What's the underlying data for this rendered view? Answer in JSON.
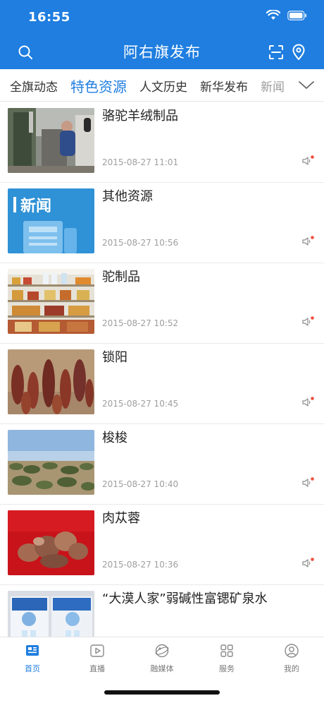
{
  "status": {
    "time": "16:55"
  },
  "header": {
    "title": "阿右旗发布"
  },
  "tabs": {
    "items": [
      {
        "label": "全旗动态"
      },
      {
        "label": "特色资源"
      },
      {
        "label": "人文历史"
      },
      {
        "label": "新华发布"
      },
      {
        "label": "新闻"
      }
    ],
    "active_index": 1
  },
  "articles": [
    {
      "title": "骆驼羊绒制品",
      "date": "2015-08-27 11:01",
      "thumb": "weaving-workshop"
    },
    {
      "title": "其他资源",
      "date": "2015-08-27 10:56",
      "thumb": "news-placeholder",
      "thumb_text": "新闻"
    },
    {
      "title": "驼制品",
      "date": "2015-08-27 10:52",
      "thumb": "product-shelf"
    },
    {
      "title": "锁阳",
      "date": "2015-08-27 10:45",
      "thumb": "cynomorium-plants"
    },
    {
      "title": "梭梭",
      "date": "2015-08-27 10:40",
      "thumb": "desert-shrubland"
    },
    {
      "title": "肉苁蓉",
      "date": "2015-08-27 10:36",
      "thumb": "cistanche-roots"
    },
    {
      "title": "“大漠人家”弱碱性富锶矿泉水",
      "date": "",
      "thumb": "water-boxes"
    }
  ],
  "tabbar": {
    "items": [
      {
        "label": "首页",
        "icon": "home-news-icon"
      },
      {
        "label": "直播",
        "icon": "play-icon"
      },
      {
        "label": "融媒体",
        "icon": "globe-icon"
      },
      {
        "label": "服务",
        "icon": "grid-icon"
      },
      {
        "label": "我的",
        "icon": "user-icon"
      }
    ],
    "active_index": 0
  },
  "colors": {
    "brand_blue": "#1f7ee0",
    "badge_red": "#f04e3e"
  }
}
